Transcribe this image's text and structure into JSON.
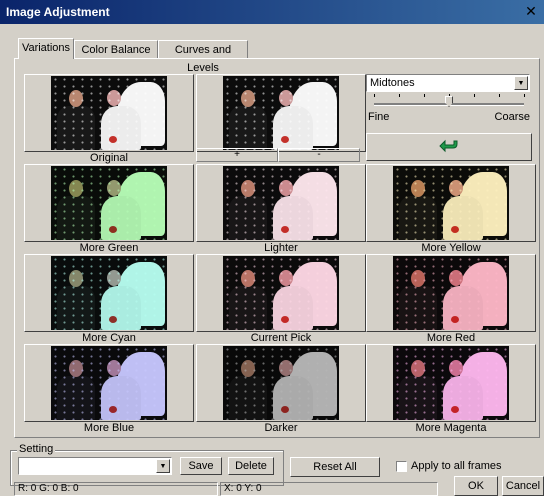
{
  "window": {
    "title": "Image Adjustment",
    "close_label": "✕"
  },
  "tabs": [
    {
      "label": "Variations",
      "active": true
    },
    {
      "label": "Color Balance",
      "active": false
    },
    {
      "label": "Curves and Levels",
      "active": false
    }
  ],
  "thumbnails": [
    {
      "label": "Original",
      "tint": "#ffffff"
    },
    {
      "label": "",
      "tint": "#ffffff"
    },
    {
      "label": "More Green",
      "tint": "#b8ffb8"
    },
    {
      "label": "Lighter",
      "tint": "#ffe8ef"
    },
    {
      "label": "More Yellow",
      "tint": "#fff2c0"
    },
    {
      "label": "More Cyan",
      "tint": "#b8fff2"
    },
    {
      "label": "Current Pick",
      "tint": "#ffd9e6"
    },
    {
      "label": "More Red",
      "tint": "#ffb8c8"
    },
    {
      "label": "More Blue",
      "tint": "#c8c8ff"
    },
    {
      "label": "Darker",
      "tint": "#b8b8b8"
    },
    {
      "label": "More Magenta",
      "tint": "#ffb8f0"
    }
  ],
  "preview_buttons": {
    "plus": "+",
    "minus": "-"
  },
  "tone_select": {
    "value": "Midtones"
  },
  "slider": {
    "min_label": "Fine",
    "max_label": "Coarse",
    "position": 0.5
  },
  "reset_icon": "undo-arrow-icon",
  "setting": {
    "legend": "Setting",
    "value": "",
    "save_label": "Save",
    "delete_label": "Delete"
  },
  "reset_all_label": "Reset All",
  "apply_all": {
    "label": "Apply to all frames",
    "checked": false
  },
  "ok_label": "OK",
  "cancel_label": "Cancel",
  "status": {
    "rgb": "R:  0 G:  0 B:  0",
    "xy": "X: 0  Y: 0"
  },
  "colors": {
    "accent_green": "#1f9a4a",
    "title_bar": "#0a246a"
  }
}
